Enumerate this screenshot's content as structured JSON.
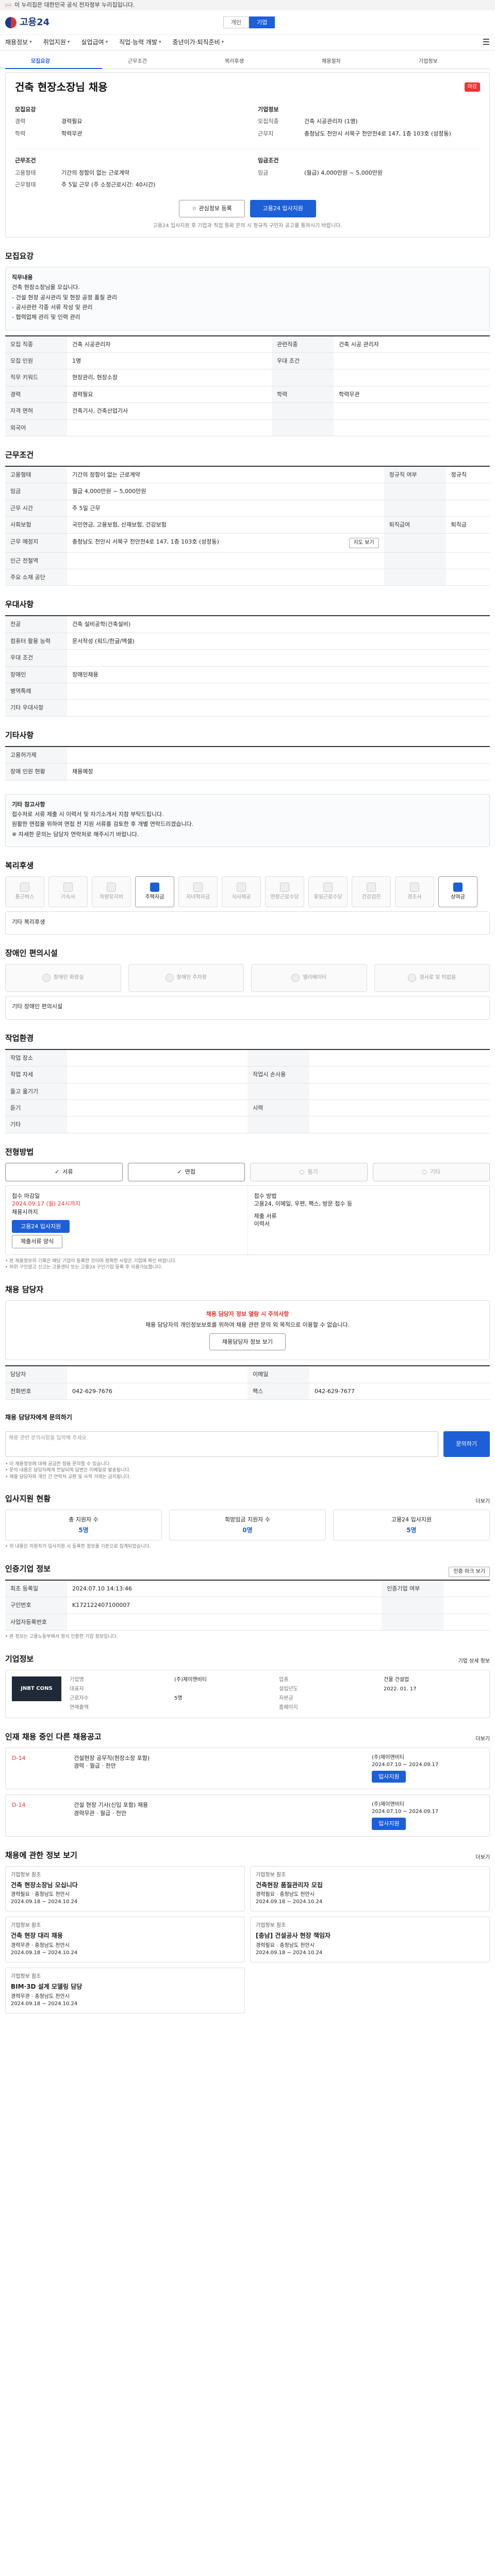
{
  "gov_bar": {
    "text": "이 누리집은 대한민국 공식 전자정부 누리집입니다."
  },
  "header": {
    "logo": "고용24",
    "tabs": [
      "개인",
      "기업"
    ]
  },
  "gnb": {
    "items": [
      "채용정보",
      "취업지원",
      "실업급여",
      "직업·능력 개발",
      "중년이가·퇴직준비"
    ]
  },
  "subtabs": [
    "모집요강",
    "근무조건",
    "복리후생",
    "채용절차",
    "기업정보"
  ],
  "job": {
    "title": "건축 현장소장님 채용",
    "badge": "마감",
    "company_heading": "모집요강",
    "company_section": "기업정보",
    "left": [
      {
        "k": "경력",
        "v": "경력필요"
      },
      {
        "k": "학력",
        "v": "학력무관"
      }
    ],
    "left2_heading": "근무조건",
    "left2": [
      {
        "k": "고용형태",
        "v": "기간의 정함이 없는 근로계약"
      },
      {
        "k": "근무형태",
        "v": "주 5일 근무 (주 소정근로시간: 40시간)"
      }
    ],
    "right": [
      {
        "k": "모집직종",
        "v": "건축 시공관리자 (1명)"
      },
      {
        "k": "근무지",
        "v": "충청남도 천안시 서북구 천안천4로 147, 1층 103호 (성정동)"
      }
    ],
    "right2_heading": "임금조건",
    "right2": [
      {
        "k": "임금",
        "v": "(월급) 4,000만원 ~ 5,000만원"
      }
    ],
    "btn_scrap": "관심정보 등록",
    "btn_apply": "고용24 입사지원",
    "note": "고용24 입사지원 후 기업과 직접 통화 문의 시 정규직 구인자 공고를 통하시기 바랍니다."
  },
  "sec_recruit": {
    "title": "모집요강",
    "desc_title": "직무내용",
    "desc_lines": [
      "건축 현장소장님을 모십니다.",
      "- 건설 현장 공사관리 및 현장 공정 품질 관리",
      "- 공사관련 각종 서류 작성 및 관리",
      "- 협력업체 관리 및 인력 관리"
    ],
    "rows": [
      {
        "k": "모집 직종",
        "v": "건축 시공관리자",
        "k2": "관련직종",
        "v2": "건축 시공 관리자"
      },
      {
        "k": "모집 인원",
        "v": "1명",
        "k2": "우대 조건",
        "v2": ""
      },
      {
        "k": "직무 키워드",
        "v": "현장관리, 현장소장",
        "k2": "",
        "v2": ""
      },
      {
        "k": "경력",
        "v": "경력필요",
        "k2": "학력",
        "v2": "학력무관"
      },
      {
        "k": "자격 면허",
        "v": "건축기사, 건축산업기사",
        "k2": "",
        "v2": ""
      },
      {
        "k": "외국어",
        "v": "",
        "k2": "",
        "v2": ""
      }
    ]
  },
  "sec_conditions": {
    "title": "근무조건",
    "rows": [
      {
        "k": "고용형태",
        "v": "기간의 정함이 없는 근로계약",
        "k2": "정규직 여부",
        "v2": "정규직"
      },
      {
        "k": "임금",
        "v": "월급 4,000만원 ~ 5,000만원",
        "k2": "",
        "v2": ""
      },
      {
        "k": "근무 시간",
        "v": "주 5일 근무",
        "k2": "",
        "v2": ""
      },
      {
        "k": "사회보험",
        "v": "국민연금, 고용보험, 산재보험, 건강보험",
        "k2": "퇴직급여",
        "v2": "퇴직금"
      },
      {
        "k": "근무 예정지",
        "v": "충청남도 천안시 서북구 천안천4로 147, 1층 103호 (성정동)",
        "k2": "",
        "v2": ""
      },
      {
        "k": "인근 전철역",
        "v": "",
        "k2": "",
        "v2": ""
      },
      {
        "k": "주요 소재 공단",
        "v": "",
        "k2": "",
        "v2": ""
      }
    ],
    "map_btn": "지도 보기"
  },
  "sec_hr": {
    "title": "우대사항",
    "rows": [
      {
        "k": "전공",
        "v": "건축 설비공학(건축설비)"
      },
      {
        "k": "컴퓨터 활용 능력",
        "v": "문서작성 (워드/한글/엑셀)"
      },
      {
        "k": "우대 조건",
        "v": ""
      },
      {
        "k": "장애인",
        "v": "장애인채용"
      },
      {
        "k": "병역특례",
        "v": ""
      },
      {
        "k": "기타 우대사항",
        "v": ""
      }
    ]
  },
  "sec_workers": {
    "title": "기타사항",
    "rows": [
      {
        "k": "고용허가제",
        "v": ""
      },
      {
        "k": "장애 인원 현황",
        "v": "채용예정"
      }
    ]
  },
  "sec_notice": {
    "title": "기타 참고사항",
    "lines": [
      "접수처로 서류 제출 시 이력서 및 자기소개서 지참 부탁드립니다.",
      "원활한 면접을 위하여 면접 전 지원 서류를 검토한 후 개별 연락드리겠습니다.",
      "※ 자세한 문의는 담당자 연락처로 해주시기 바랍니다."
    ]
  },
  "sec_benefits": {
    "title": "복리후생",
    "items": [
      {
        "label": "통근버스",
        "on": false
      },
      {
        "label": "기숙사",
        "on": false
      },
      {
        "label": "차량유지비",
        "on": false
      },
      {
        "label": "주택자금",
        "on": true
      },
      {
        "label": "자녀학자금",
        "on": false
      },
      {
        "label": "식사제공",
        "on": false
      },
      {
        "label": "연장근로수당",
        "on": false
      },
      {
        "label": "휴일근로수당",
        "on": false
      },
      {
        "label": "건강검진",
        "on": false
      },
      {
        "label": "경조사",
        "on": false
      },
      {
        "label": "상여금",
        "on": true
      }
    ],
    "etc_label": "기타 복리후생"
  },
  "sec_access": {
    "title": "장애인 편의시설",
    "items": [
      "장애인 화장실",
      "장애인 주차장",
      "엘리베이터",
      "경사로 및 턱없음"
    ],
    "etc_label": "기타 장애인 편의시설"
  },
  "sec_env": {
    "title": "작업환경",
    "rows": [
      {
        "k": "작업 장소",
        "v": "",
        "k2": "",
        "v2": ""
      },
      {
        "k": "작업 자세",
        "v": "",
        "k2": "작업시 손사용",
        "v2": ""
      },
      {
        "k": "들고 옮기기",
        "v": "",
        "k2": "",
        "v2": ""
      },
      {
        "k": "듣기",
        "v": "",
        "k2": "시력",
        "v2": ""
      },
      {
        "k": "기타",
        "v": "",
        "k2": "",
        "v2": ""
      }
    ]
  },
  "sec_process": {
    "title": "전형방법",
    "steps": [
      {
        "label": "서류",
        "on": true
      },
      {
        "label": "면접",
        "on": true
      },
      {
        "label": "필기",
        "on": false
      },
      {
        "label": "기타",
        "on": false
      }
    ],
    "deadline_label": "접수 마감일",
    "deadline_value": "채용시까지",
    "deadline_date": "2024.09.17 (월) 24시까지",
    "method_label": "접수 방법",
    "method_value": "고용24, 이메일, 우편, 팩스, 방문 접수 등",
    "doc_label": "제출 서류",
    "doc_value": "이력서",
    "apply_btn": "고용24 입사지원",
    "doc_btn": "제출서류 양식",
    "footnotes": [
      "• 본 채용정보의 기록은 해당 기업이 등록한 것이며 정확한 사항은 기업에 확인 바랍니다.",
      "• 허위 구인광고 신고는 고용센터 또는 고용24 구인기업 등록 후 이용가능합니다."
    ]
  },
  "sec_contact": {
    "title": "채용 담당자",
    "alert_head": "채용 담당자 정보 열람 시 주의사항",
    "alert_text": "채용 담당자의 개인정보보호를 위하여 채용 관련 문의 외 목적으로 이용할 수 없습니다.",
    "alert_btn": "채용담당자 정보 보기",
    "contact_label": "담당자",
    "phone_label": "전화번호",
    "phone_value": "042-629-7676",
    "email_label": "이메일",
    "fax_label": "팩스",
    "fax_value": "042-629-7677"
  },
  "sec_question": {
    "title": "채용 담당자에게 문의하기",
    "placeholder": "채용 관련 문의사항을 입력해 주세요.",
    "send_btn": "문의하기",
    "note_lines": [
      "• 이 채용정보에 대해 궁금한 점을 문의할 수 있습니다.",
      "• 문의 내용은 담당자에게 전달되며 답변은 이메일로 발송됩니다.",
      "• 채용 담당자와 개인 간 연락처 교환 및 사적 거래는 금지됩니다."
    ]
  },
  "sec_stats": {
    "title": "입사지원 현황",
    "more": "더보기",
    "items": [
      {
        "label": "총 지원자 수",
        "value": "5명"
      },
      {
        "label": "희망임금 지원자 수",
        "value": "0명"
      },
      {
        "label": "고용24 입사지원",
        "value": "5명"
      }
    ],
    "note": "• 위 내용은 지원자가 입사지원 시 등록한 정보를 기준으로 집계되었습니다."
  },
  "sec_info": {
    "title": "인증기업 정보",
    "more_btn": "인증 마크 보기",
    "rows": [
      {
        "k": "최초 등록일",
        "v": "2024.07.10 14:13:46",
        "k2": "인증기업 여부",
        "v2": ""
      },
      {
        "k": "구인번호",
        "v": "K172122407100007",
        "k2": "",
        "v2": ""
      },
      {
        "k": "사업자등록번호",
        "v": "",
        "k2": "",
        "v2": ""
      }
    ],
    "footnote": "• 본 정보는 고용노동부에서 정식 인증한 기업 정보입니다."
  },
  "sec_company": {
    "title": "기업정보",
    "logo": "JNBT CONS",
    "more": "기업 상세 정보",
    "fields": [
      {
        "k": "기업명",
        "v": "(주)제이앤비티"
      },
      {
        "k": "업종",
        "v": "건물 건설업"
      },
      {
        "k": "대표자",
        "v": ""
      },
      {
        "k": "설립년도",
        "v": "2022. 01. 17"
      },
      {
        "k": "근로자수",
        "v": "5명"
      },
      {
        "k": "자본금",
        "v": ""
      },
      {
        "k": "연매출액",
        "v": ""
      },
      {
        "k": "홈페이지",
        "v": ""
      }
    ]
  },
  "sec_more": {
    "title": "인재 채용 중인 다른 채용공고",
    "more": "더보기",
    "items": [
      {
        "dday": "D-14",
        "title": "건설현장 공무직(현장소장 포함)",
        "detail": "경력 · 월급 · 천안",
        "company": "(주)제이앤비티",
        "period": "2024.07.10 ~ 2024.09.17",
        "btn": "입사지원"
      },
      {
        "dday": "D-14",
        "title": "건설 현장 기사(신입 포함) 채용",
        "detail": "경력무관 · 월급 · 천안",
        "company": "(주)제이앤비티",
        "period": "2024.07.10 ~ 2024.09.17",
        "btn": "입사지원"
      }
    ]
  },
  "sec_rec": {
    "title": "채용에 관한 정보 보기",
    "more": "더보기",
    "items": [
      {
        "company": "기업정보 참조",
        "title": "건축 현장소장님 모십니다",
        "meta": "경력필요 · 충청남도 천안시",
        "date": "2024.09.18 ~ 2024.10.24"
      },
      {
        "company": "기업정보 참조",
        "title": "건축현장 품질관리자 모집",
        "meta": "경력필요 · 충청남도 천안시",
        "date": "2024.09.18 ~ 2024.10.24"
      },
      {
        "company": "기업정보 참조",
        "title": "건축 현장 대리 채용",
        "meta": "경력무관 · 충청남도 천안시",
        "date": "2024.09.18 ~ 2024.10.24"
      },
      {
        "company": "기업정보 참조",
        "title": "[충남] 건설공사 현장 책임자",
        "meta": "경력필요 · 충청남도 천안시",
        "date": "2024.09.18 ~ 2024.10.24"
      },
      {
        "company": "기업정보 참조",
        "title": "BIM·3D 설계 모델링 담당",
        "meta": "경력무관 · 충청남도 천안시",
        "date": "2024.09.18 ~ 2024.10.24"
      }
    ]
  }
}
